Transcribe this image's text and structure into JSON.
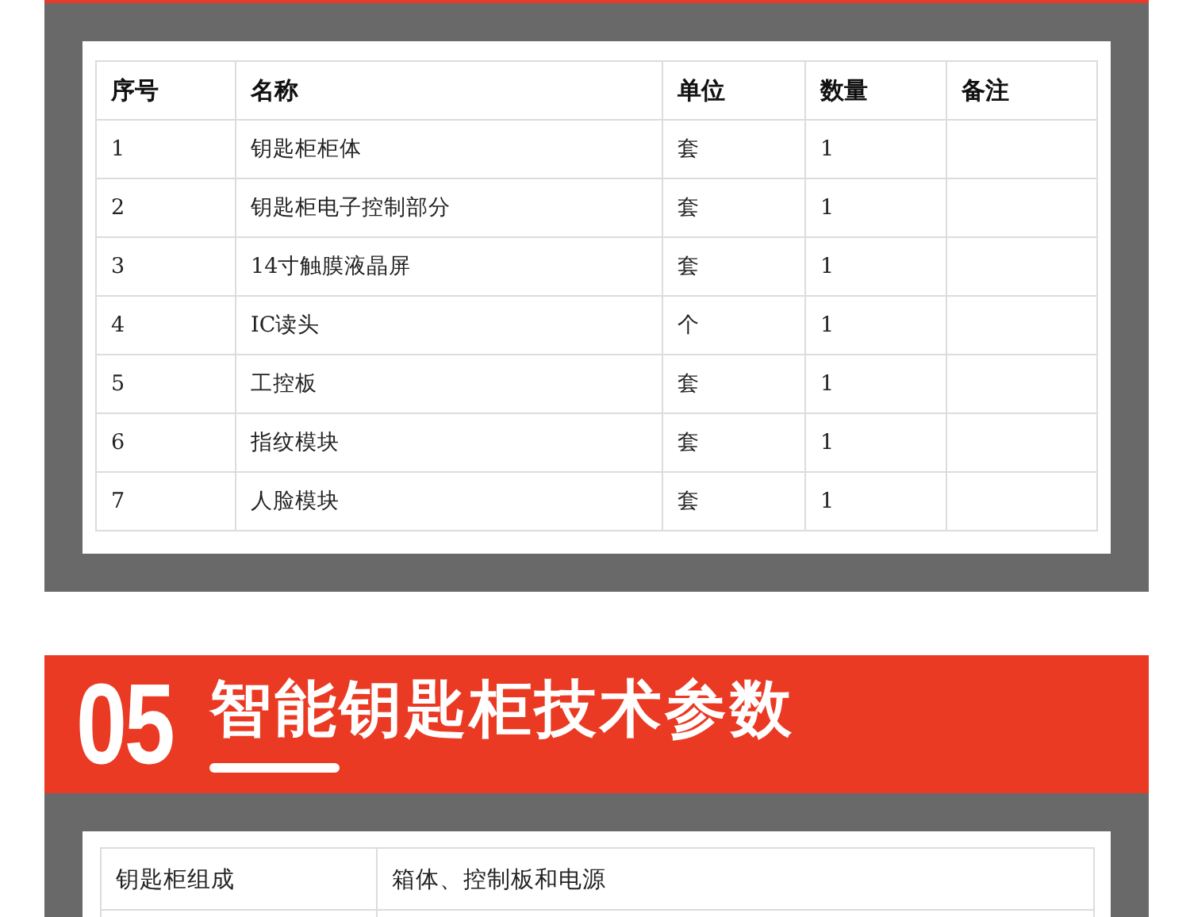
{
  "parts_table": {
    "columns": [
      "序号",
      "名称",
      "单位",
      "数量",
      "备注"
    ],
    "rows": [
      [
        "1",
        "钥匙柜柜体",
        "套",
        "1",
        ""
      ],
      [
        "2",
        "钥匙柜电子控制部分",
        "套",
        "1",
        ""
      ],
      [
        "3",
        "14寸触膜液晶屏",
        "套",
        "1",
        ""
      ],
      [
        "4",
        "IC读头",
        "个",
        "1",
        ""
      ],
      [
        "5",
        "工控板",
        "套",
        "1",
        ""
      ],
      [
        "6",
        "指纹模块",
        "套",
        "1",
        ""
      ],
      [
        "7",
        "人脸模块",
        "套",
        "1",
        ""
      ]
    ]
  },
  "section_banner": {
    "number": "05",
    "title": "智能钥匙柜技术参数"
  },
  "spec_table": {
    "rows": [
      [
        "钥匙柜组成",
        "箱体、控制板和电源"
      ]
    ]
  }
}
